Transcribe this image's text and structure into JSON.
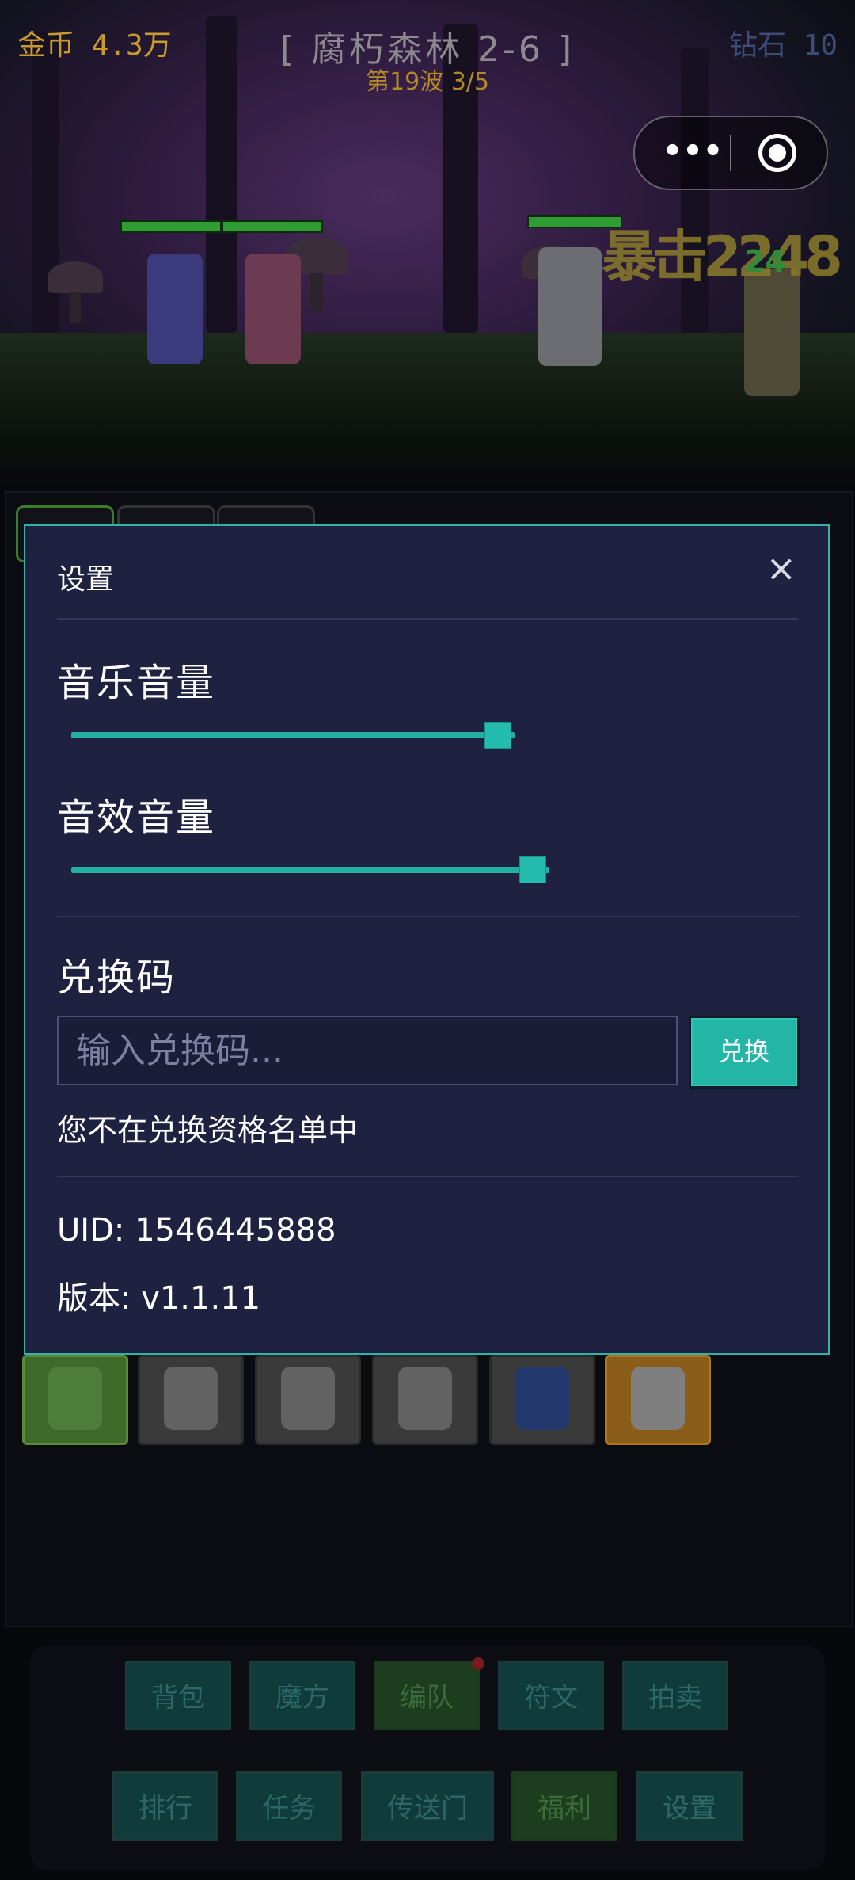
{
  "hud": {
    "gold": "金币 4.3万",
    "stage": "[ 腐朽森林 2-6 ]",
    "wave": "第19波 3/5",
    "diamond": "钻石 10",
    "crit_text": "暴击2248",
    "damage_number": "24"
  },
  "capsule": {
    "more_icon": "more-dots",
    "close_icon": "target-circle"
  },
  "dialog": {
    "title": "设置",
    "close_label": "×",
    "music_volume": {
      "label": "音乐音量",
      "level_fraction": 0.95
    },
    "sfx_volume": {
      "label": "音效音量",
      "level_fraction": 1.0
    },
    "redeem": {
      "section_label": "兑换码",
      "placeholder": "输入兑换码...",
      "value": "",
      "button_label": "兑换",
      "status": "您不在兑换资格名单中"
    },
    "uid_line": "UID: 1546445888",
    "version_line": "版本: v1.1.11"
  },
  "bottom_nav": {
    "row1": [
      "背包",
      "魔方",
      "编队",
      "符文",
      "拍卖"
    ],
    "row2": [
      "排行",
      "任务",
      "传送门",
      "福利",
      "设置"
    ]
  },
  "colors": {
    "accent": "#23b5a6",
    "dialog_bg": "#1e2140",
    "dialog_border": "#35b2a7",
    "gold": "#c99b2a"
  }
}
